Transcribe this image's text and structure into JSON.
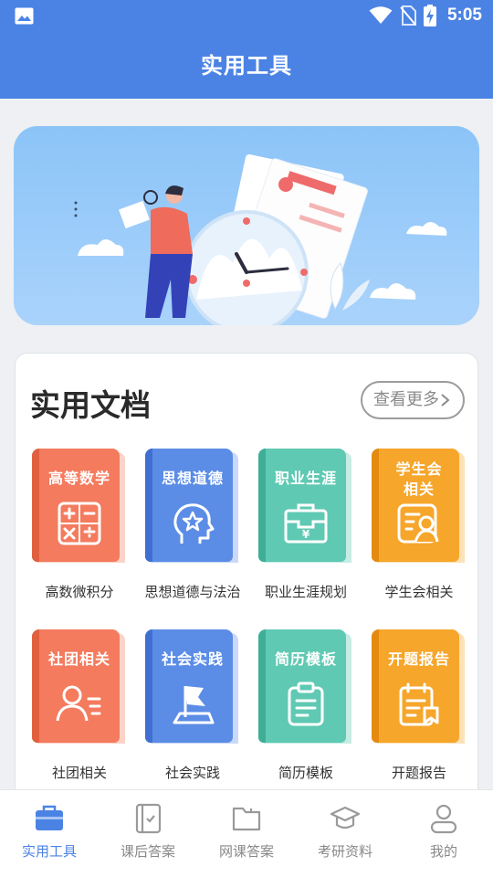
{
  "status": {
    "time": "5:05"
  },
  "header": {
    "title": "实用工具"
  },
  "section": {
    "title": "实用文档",
    "more_label": "查看更多"
  },
  "items": [
    {
      "cover": "高等数学",
      "caption": "高数微积分",
      "color": "#f47b5e",
      "spine": "#e0603f",
      "back": "#fbd3c8",
      "icon": "calculator-icon"
    },
    {
      "cover": "思想道德",
      "caption": "思想道德与法治",
      "color": "#5b8de6",
      "spine": "#3f6fd0",
      "back": "#c9d9f7",
      "icon": "head-star-icon"
    },
    {
      "cover": "职业生涯",
      "caption": "职业生涯规划",
      "color": "#5fc9b3",
      "spine": "#3fae97",
      "back": "#c6ece4",
      "icon": "briefcase-icon"
    },
    {
      "cover": "学生会\n相关",
      "caption": "学生会相关",
      "color": "#f6a62b",
      "spine": "#e48a10",
      "back": "#fde2b8",
      "icon": "id-card-icon"
    },
    {
      "cover": "社团相关",
      "caption": "社团相关",
      "color": "#f47b5e",
      "spine": "#e0603f",
      "back": "#fbd3c8",
      "icon": "user-list-icon"
    },
    {
      "cover": "社会实践",
      "caption": "社会实践",
      "color": "#5b8de6",
      "spine": "#3f6fd0",
      "back": "#c9d9f7",
      "icon": "flag-icon"
    },
    {
      "cover": "简历模板",
      "caption": "简历模板",
      "color": "#5fc9b3",
      "spine": "#3fae97",
      "back": "#c6ece4",
      "icon": "clipboard-icon"
    },
    {
      "cover": "开题报告",
      "caption": "开题报告",
      "color": "#f6a62b",
      "spine": "#e48a10",
      "back": "#fde2b8",
      "icon": "report-icon"
    }
  ],
  "nav": [
    {
      "label": "实用工具",
      "icon": "toolbox-icon",
      "active": true
    },
    {
      "label": "课后答案",
      "icon": "notebook-icon",
      "active": false
    },
    {
      "label": "网课答案",
      "icon": "folder-icon",
      "active": false
    },
    {
      "label": "考研资料",
      "icon": "graduation-cap-icon",
      "active": false
    },
    {
      "label": "我的",
      "icon": "user-icon",
      "active": false
    }
  ],
  "colors": {
    "primary": "#4b83e4",
    "inactive": "#888888"
  }
}
